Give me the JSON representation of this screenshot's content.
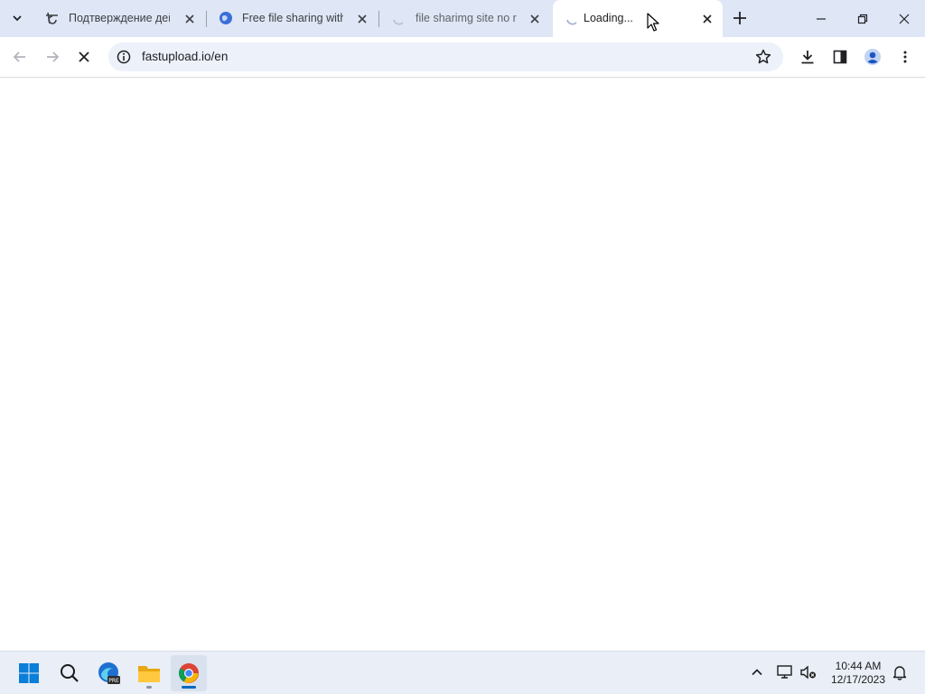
{
  "browser": {
    "tabs": [
      {
        "title": "Подтверждение действия",
        "favicon": "captcha-icon",
        "active": false
      },
      {
        "title": "Free file sharing without registration",
        "favicon": "globe-icon",
        "active": false
      },
      {
        "title": "file sharimg site no registration",
        "favicon": "loading-spinner-icon",
        "active": false
      },
      {
        "title": "Loading...",
        "favicon": "loading-spinner-icon",
        "active": true
      }
    ],
    "address_bar": {
      "url": "fastupload.io/en"
    },
    "colors": {
      "tabstrip": "#dfe6f5",
      "omnibox": "#edf1fa",
      "accent": "#0b57d0"
    }
  },
  "taskbar": {
    "apps": [
      "start-icon",
      "search-icon",
      "edge-preview-icon",
      "file-explorer-icon",
      "chrome-icon"
    ],
    "clock": {
      "time": "10:44 AM",
      "date": "12/17/2023"
    }
  }
}
